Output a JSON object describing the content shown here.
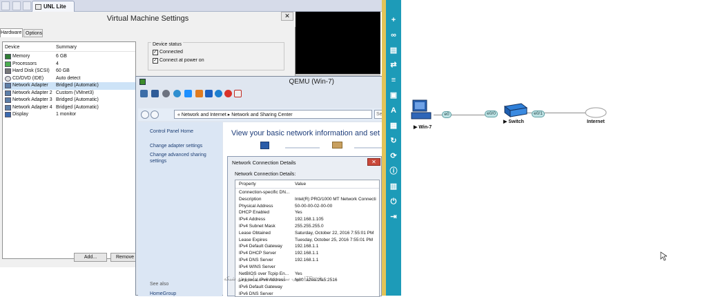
{
  "browser": {
    "active_tab": "UNL Lite"
  },
  "vm_settings": {
    "title": "Virtual Machine Settings",
    "close": "✕",
    "tabs": [
      "Hardware",
      "Options"
    ],
    "columns": [
      "Device",
      "Summary"
    ],
    "devices": [
      {
        "name": "Memory",
        "summary": "6 GB"
      },
      {
        "name": "Processors",
        "summary": "4"
      },
      {
        "name": "Hard Disk (SCSI)",
        "summary": "60 GB"
      },
      {
        "name": "CD/DVD (IDE)",
        "summary": "Auto detect"
      },
      {
        "name": "Network Adapter",
        "summary": "Bridged (Automatic)"
      },
      {
        "name": "Network Adapter 2",
        "summary": "Custom (VMnet3)"
      },
      {
        "name": "Network Adapter 3",
        "summary": "Bridged (Automatic)"
      },
      {
        "name": "Network Adapter 4",
        "summary": "Bridged (Automatic)"
      },
      {
        "name": "Display",
        "summary": "1 monitor"
      }
    ],
    "device_status": {
      "title": "Device status",
      "connected": "Connected",
      "connect_at_power_on": "Connect at power on"
    },
    "buttons": {
      "add": "Add...",
      "remove": "Remove"
    }
  },
  "qemu": {
    "title": "QEMU (Win-7)",
    "breadcrumb": "Network and Internet ▸ Network and Sharing Center",
    "search_prefix": "Se",
    "left_links": {
      "home": "Control Panel Home",
      "adapter": "Change adapter settings",
      "advanced": "Change advanced sharing settings",
      "see_also": "See also",
      "homegroup": "HomeGroup"
    },
    "heading": "View your basic network information and set up co",
    "details": {
      "title": "Network Connection Details",
      "close": "✕",
      "subtitle": "Network Connection Details:",
      "columns": [
        "Property",
        "Value"
      ],
      "rows": [
        {
          "property": "Connection-specific DN...",
          "value": ""
        },
        {
          "property": "Description",
          "value": "Intel(R) PRO/1000 MT Network Connecti"
        },
        {
          "property": "Physical Address",
          "value": "50-00-00-02-00-00"
        },
        {
          "property": "DHCP Enabled",
          "value": "Yes"
        },
        {
          "property": "IPv4 Address",
          "value": "192.168.1.105"
        },
        {
          "property": "IPv4 Subnet Mask",
          "value": "255.255.255.0"
        },
        {
          "property": "Lease Obtained",
          "value": "Saturday, October 22, 2016 7:55:01 PM"
        },
        {
          "property": "Lease Expires",
          "value": "Tuesday, October 25, 2016 7:55:01 PM"
        },
        {
          "property": "IPv4 Default Gateway",
          "value": "192.168.1.1"
        },
        {
          "property": "IPv4 DHCP Server",
          "value": "192.168.1.1"
        },
        {
          "property": "IPv4 DNS Server",
          "value": "192.168.1.1"
        },
        {
          "property": "IPv4 WINS Server",
          "value": ""
        },
        {
          "property": "NetBIOS over Tcpip En...",
          "value": "Yes"
        },
        {
          "property": "Link-local IPv6 Address",
          "value": "fe80::a2ea:2fa5:2516"
        },
        {
          "property": "IPv6 Default Gateway",
          "value": ""
        },
        {
          "property": "IPv6 DNS Server",
          "value": ""
        }
      ]
    }
  },
  "watermark": "وب سایت تخصصی آموزش شبکه - ITPro.ir",
  "unl_toolbar": {
    "icons": [
      "plus-icon",
      "link-icon",
      "image-icon",
      "swap-icon",
      "list-icon",
      "picture-icon",
      "text-icon",
      "grid-icon",
      "refresh-icon",
      "refresh-alt-icon",
      "info-icon",
      "notes-icon",
      "power-icon",
      "logout-icon"
    ],
    "accent_color": "#1d9bb8"
  },
  "topology": {
    "nodes": {
      "win7": "Win-7",
      "switch": "Switch",
      "internet": "Internet"
    },
    "ports": {
      "win7_e0": "e0",
      "switch_e00": "e0/0",
      "switch_e01": "e0/1"
    }
  }
}
